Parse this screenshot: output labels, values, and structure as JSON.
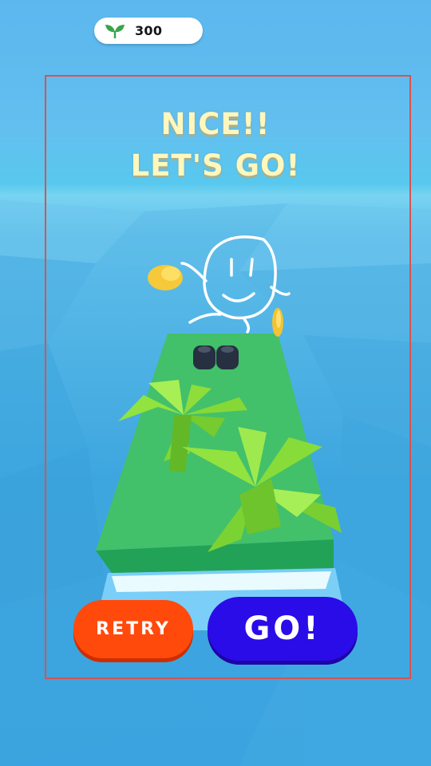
{
  "hud": {
    "currency_icon": "leaf-icon",
    "currency_value": "300"
  },
  "headline": {
    "line1": "NICE!!",
    "line2": "LET'S GO!"
  },
  "buttons": {
    "retry_label": "RETRY",
    "go_label": "GO!"
  },
  "colors": {
    "retry": "#ff4a0c",
    "go": "#2a0ce8",
    "headline": "#fff7bd",
    "platform_top": "#42bf6a",
    "palm_leaf": "#8ee03a",
    "coin": "#f5c93a"
  }
}
